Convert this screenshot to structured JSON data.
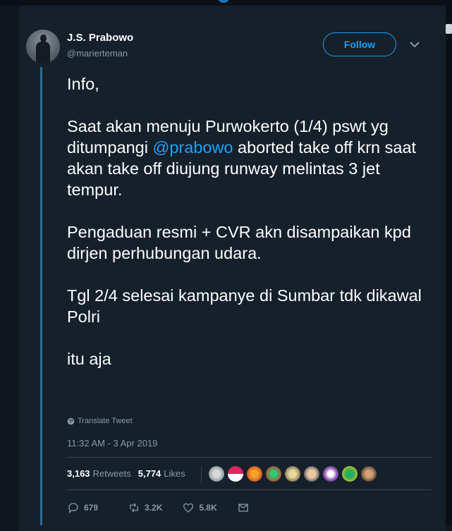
{
  "user": {
    "name": "J.S. Prabowo",
    "handle": "@marierteman"
  },
  "follow_button": "Follow",
  "tweet": {
    "line1": "Info,",
    "para2_before": "Saat akan menuju Purwokerto (1/4) pswt yg ditumpangi ",
    "mention": "@prabowo",
    "para2_after": " aborted take off krn saat akan take off diujung runway melintas 3 jet tempur.",
    "para3": "Pengaduan resmi + CVR akn disampaikan kpd dirjen perhubungan udara.",
    "para4": "Tgl 2/4 selesai kampanye di Sumbar tdk dikawal Polri",
    "para5": "itu aja"
  },
  "translate_label": "Translate Tweet",
  "timestamp": "11:32 AM - 3 Apr 2019",
  "stats": {
    "retweets_count": "3,163",
    "retweets_label": "Retweets",
    "likes_count": "5,774",
    "likes_label": "Likes"
  },
  "actions": {
    "replies": "679",
    "retweets": "3.2K",
    "likes": "5.8K"
  },
  "colors": {
    "background": "#15202b",
    "accent": "#1da1f2",
    "muted": "#8899a6"
  },
  "icons": [
    "globe-icon",
    "chevron-down-icon",
    "reply-icon",
    "retweet-icon",
    "heart-icon",
    "message-icon"
  ]
}
